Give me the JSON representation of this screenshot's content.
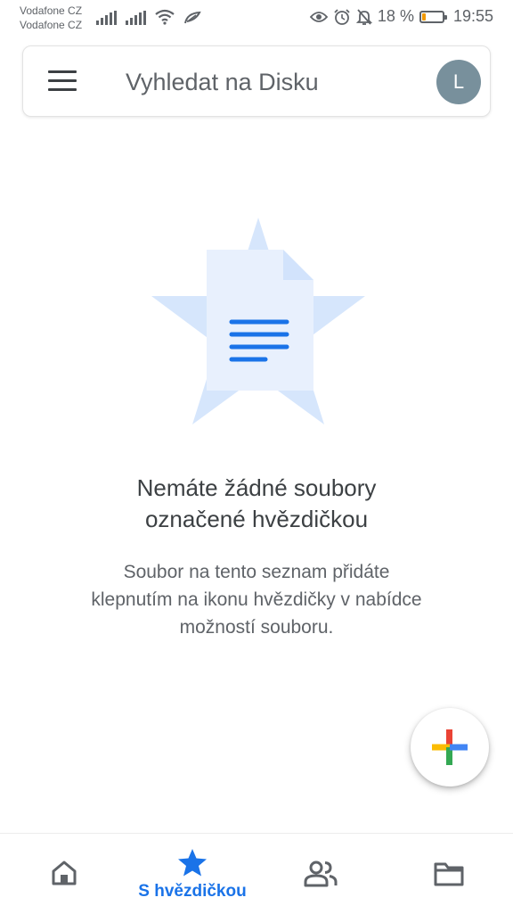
{
  "status_bar": {
    "carrier_1": "Vodafone CZ",
    "carrier_2": "Vodafone CZ",
    "battery_percent_text": "18 %",
    "battery_level": 0.18,
    "time": "19:55",
    "icons": [
      "signal-icon",
      "signal-icon",
      "wifi-icon",
      "data-saver-icon",
      "eye-icon",
      "alarm-icon",
      "notifications-off-icon",
      "battery-icon"
    ]
  },
  "search": {
    "placeholder": "Vyhledat na Disku",
    "avatar_letter": "L",
    "avatar_color": "#78909c"
  },
  "empty_state": {
    "title_line1": "Nemáte žádné soubory",
    "title_line2": "označené hvězdičkou",
    "desc_line1": "Soubor na tento seznam přidáte",
    "desc_line2": "klepnutím na ikonu hvězdičky v nabídce",
    "desc_line3": "možností souboru."
  },
  "fab": {
    "icon": "add-icon",
    "colors": [
      "#ea4335",
      "#fbbc04",
      "#34a853",
      "#4285f4"
    ]
  },
  "bottom_nav": {
    "items": [
      {
        "icon": "home-icon",
        "label": "",
        "active": false
      },
      {
        "icon": "star-icon",
        "label": "S hvězdičkou",
        "active": true
      },
      {
        "icon": "shared-people-icon",
        "label": "",
        "active": false
      },
      {
        "icon": "folder-icon",
        "label": "",
        "active": false
      }
    ],
    "accent_color": "#1a73e8"
  }
}
